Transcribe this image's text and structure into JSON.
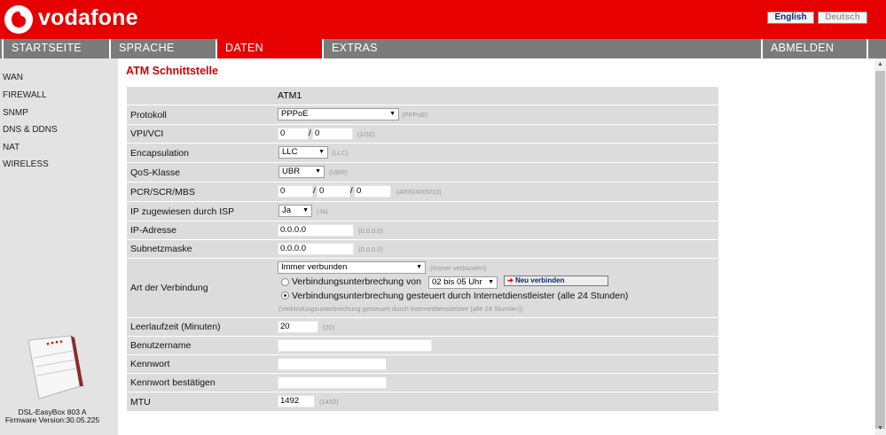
{
  "header": {
    "brand": "vodafone",
    "lang_en": "English",
    "lang_de": "Deutsch",
    "brand_color": "#e60000"
  },
  "nav": {
    "items": [
      "STARTSEITE",
      "SPRACHE",
      "DATEN",
      "EXTRAS",
      "ABMELDEN"
    ],
    "active": "DATEN"
  },
  "sidebar": {
    "items": [
      "WAN",
      "FIREWALL",
      "SNMP",
      "DNS & DDNS",
      "NAT",
      "WIRELESS"
    ],
    "device_name": "DSL-EasyBox 803 A",
    "firmware": "Firmware Version:30.05.225"
  },
  "main": {
    "title": "ATM Schnittstelle",
    "column_header": "ATM1",
    "protokoll": {
      "label": "Protokoll",
      "value": "PPPoE",
      "hint": "(PPPoE)"
    },
    "vpi_vci": {
      "label": "VPI/VCI",
      "vpi": "0",
      "vci": "0",
      "sep": "/",
      "hint": "(1/32)"
    },
    "encapsulation": {
      "label": "Encapsulation",
      "value": "LLC",
      "hint": "(LLC)"
    },
    "qos": {
      "label": "QoS-Klasse",
      "value": "UBR",
      "hint": "(UBR)"
    },
    "pcr": {
      "label": "PCR/SCR/MBS",
      "pcr": "0",
      "scr": "0",
      "mbs": "0",
      "sep": "/",
      "hint": "(4000/4000/10)"
    },
    "ip_isp": {
      "label": "IP zugewiesen durch ISP",
      "value": "Ja",
      "hint": "(Ja)"
    },
    "ip": {
      "label": "IP-Adresse",
      "value": "0.0.0.0",
      "hint": "(0.0.0.0)"
    },
    "subnet": {
      "label": "Subnetzmaske",
      "value": "0.0.0.0",
      "hint": "(0.0.0.0)"
    },
    "connection": {
      "label": "Art der Verbindung",
      "value": "Immer verbunden",
      "hint": "(Immer verbunden)",
      "radio1_label": "Verbindungsunterbrechung von",
      "radio1_select": "02 bis 05 Uhr",
      "reconnect_button": "Neu verbinden",
      "radio2_label": "Verbindungsunterbrechung gesteuert durch Internetdienstleister (alle 24 Stunden)",
      "radio2_hint": "(Verbindungsunterbrechung gesteuert durch Internetdienstleister (alle 24 Stunden))"
    },
    "idle": {
      "label": "Leerlaufzeit (Minuten)",
      "value": "20",
      "hint": "(20)"
    },
    "username": {
      "label": "Benutzername",
      "value": ""
    },
    "password": {
      "label": "Kennwort",
      "value": ""
    },
    "password_confirm": {
      "label": "Kennwort bestätigen",
      "value": ""
    },
    "mtu": {
      "label": "MTU",
      "value": "1492",
      "hint": "(1492)"
    }
  }
}
